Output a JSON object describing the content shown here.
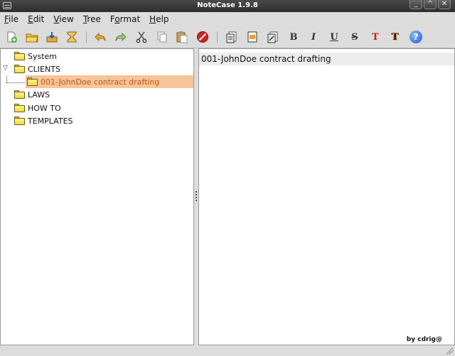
{
  "window": {
    "title": "NoteCase 1.9.8"
  },
  "menu": [
    {
      "u": "F",
      "rest": "ile"
    },
    {
      "u": "E",
      "rest": "dit"
    },
    {
      "u": "V",
      "rest": "iew"
    },
    {
      "u": "T",
      "rest": "ree"
    },
    {
      "pre": "F",
      "u": "o",
      "rest": "rmat"
    },
    {
      "u": "H",
      "rest": "elp"
    }
  ],
  "toolbar": {
    "format_bold": "B",
    "format_italic": "I",
    "format_underline": "U",
    "format_strike": "S",
    "format_text_color": "T",
    "format_bg_color": "T",
    "help": "?"
  },
  "tree": {
    "nodes": [
      {
        "label": "System"
      },
      {
        "label": "CLIENTS"
      },
      {
        "label": "001-JohnDoe contract drafting"
      },
      {
        "label": "LAWS"
      },
      {
        "label": "HOW TO"
      },
      {
        "label": "TEMPLATES"
      }
    ]
  },
  "editor": {
    "content": "001-JohnDoe contract drafting"
  },
  "status": {
    "text": "by cdrig@"
  },
  "colors": {
    "selection": "#f7c49a",
    "selection_text": "#c15a12",
    "titlebar": "#2c2c2c"
  }
}
